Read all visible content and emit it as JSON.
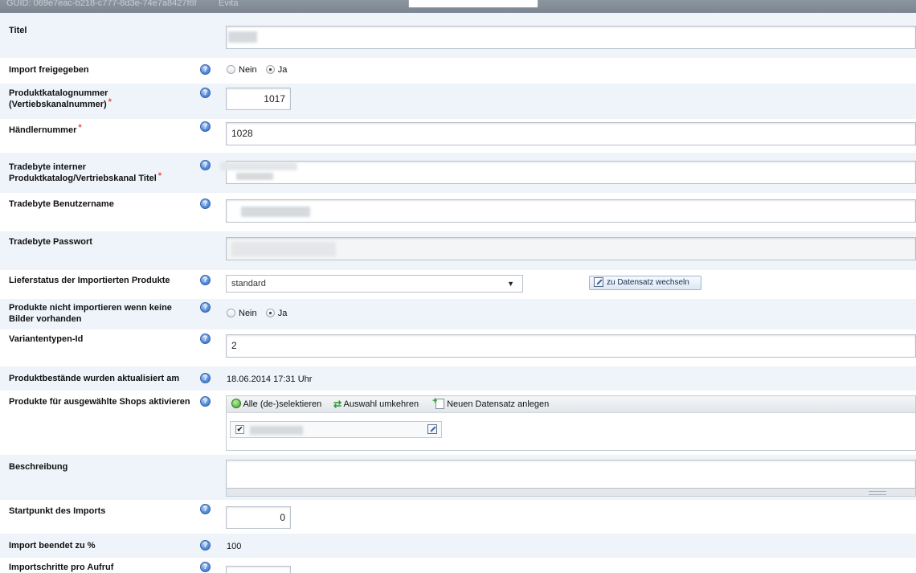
{
  "topbar": {
    "guid": "GUID: 069e7eac-b218-c777-8d3e-74e7a8427f6f",
    "app": "Evita"
  },
  "fields": {
    "titel": {
      "label": "Titel"
    },
    "import_freigegeben": {
      "label": "Import freigegeben",
      "options": [
        "Nein",
        "Ja"
      ],
      "selected": "Ja"
    },
    "katalognummer": {
      "label_line1": "Produktkatalognummer",
      "label_line2": "(Vertiebskanalnummer)",
      "required": "*",
      "value": "1017"
    },
    "haendlernummer": {
      "label": "Händlernummer",
      "required": "*",
      "value": "1028"
    },
    "tb_titel": {
      "label_line1": "Tradebyte interner",
      "label_line2": "Produktkatalog/Vertriebskanal Titel",
      "required": "*"
    },
    "tb_benutzer": {
      "label": "Tradebyte Benutzername"
    },
    "tb_passwort": {
      "label": "Tradebyte Passwort"
    },
    "lieferstatus": {
      "label": "Lieferstatus der Importierten Produkte",
      "value": "standard",
      "button": "zu Datensatz wechseln"
    },
    "keine_bilder": {
      "label_line1": "Produkte nicht importieren wenn keine",
      "label_line2": "Bilder vorhanden",
      "options": [
        "Nein",
        "Ja"
      ],
      "selected": "Ja"
    },
    "variantentypen": {
      "label": "Variantentypen-Id",
      "value": "2"
    },
    "bestaende": {
      "label": "Produktbestände wurden aktualisiert am",
      "value": "18.06.2014 17:31 Uhr"
    },
    "shops": {
      "label": "Produkte für ausgewählte Shops aktivieren",
      "toolbar": [
        "Alle (de-)selektieren",
        "Auswahl umkehren",
        "Neuen Datensatz anlegen"
      ],
      "item_checked": "✔"
    },
    "beschreibung": {
      "label": "Beschreibung"
    },
    "startpunkt": {
      "label": "Startpunkt des Imports",
      "value": "0"
    },
    "beendet": {
      "label": "Import beendet zu %",
      "value": "100"
    },
    "importschritte": {
      "label": "Importschritte pro Aufruf"
    }
  },
  "help_glyph": "?",
  "colors": {
    "alt_row": "#eef4fa",
    "required": "#e0524a",
    "topbar": "#8c96a1"
  }
}
